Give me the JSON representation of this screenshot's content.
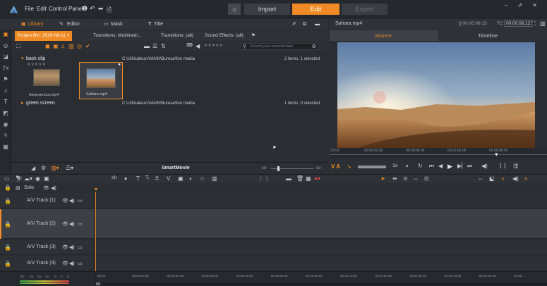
{
  "menu": {
    "file": "File",
    "edit": "Edit",
    "control_panel": "Control Panel"
  },
  "modes": {
    "import": "Import",
    "edit": "Edit",
    "export": "Export"
  },
  "colors": {
    "accent": "#f08a24",
    "bg": "#2a2d31",
    "selected_track": "#3c4046"
  },
  "tabs": {
    "library": "Library",
    "editor": "Editor",
    "mask": "Mask",
    "title": "Title"
  },
  "file_tabs": [
    "Project Bin: 2020-08-11 ×",
    "Transitions: Multimedi...",
    "Transitions: (all)",
    "Sound Effects: (all)"
  ],
  "search": {
    "placeholder": "Search your current view"
  },
  "rating": "★★★★★",
  "groups": [
    {
      "name": "back clip",
      "path": "C:\\Utilisateurs\\MAIN\\Bureau\\fun media",
      "count": "2 items, 1 selected",
      "rating": "★★★★★"
    },
    {
      "name": "green screen",
      "path": "C:\\Utilisateurs\\MAIN\\Bureau\\fun media",
      "count": "1 items, 0 selected"
    }
  ],
  "clips": [
    {
      "name": "Amersencov.mp4"
    },
    {
      "name": "Sahara.mp4"
    }
  ],
  "smartmovie": "SmartMovie",
  "preview": {
    "filename": "Sahara.mp4",
    "duration": "[] 00:00:09.15",
    "tc_label": "TC",
    "timecode": "00:00:08.12",
    "tab_source": "Source",
    "tab_timeline": "Timeline",
    "ruler": [
      "00.00",
      "00:00:02.00",
      "00:00:04.00",
      "00:00:06.00",
      "00:00:08.00"
    ],
    "speed": "1x"
  },
  "timeline": {
    "solo": "Solo",
    "tracks": [
      "A/V Track (1)",
      "A/V Track (2)",
      "A/V Track (3)",
      "A/V Track (4)"
    ],
    "ruler": [
      "00:00",
      "00:00:10.00",
      "00:00:20.00",
      "00:00:30.00",
      "00:00:40.00",
      "00:00:50.00",
      "00:01:00.00",
      "00:01:10.00",
      "00:01:20.00",
      "00:01:30.00",
      "00:01:40.00",
      "00:01:50.00",
      "00:02:..."
    ],
    "meter": [
      "-60",
      "-22",
      "-16",
      "-10",
      "-6",
      "-3",
      "0"
    ]
  }
}
